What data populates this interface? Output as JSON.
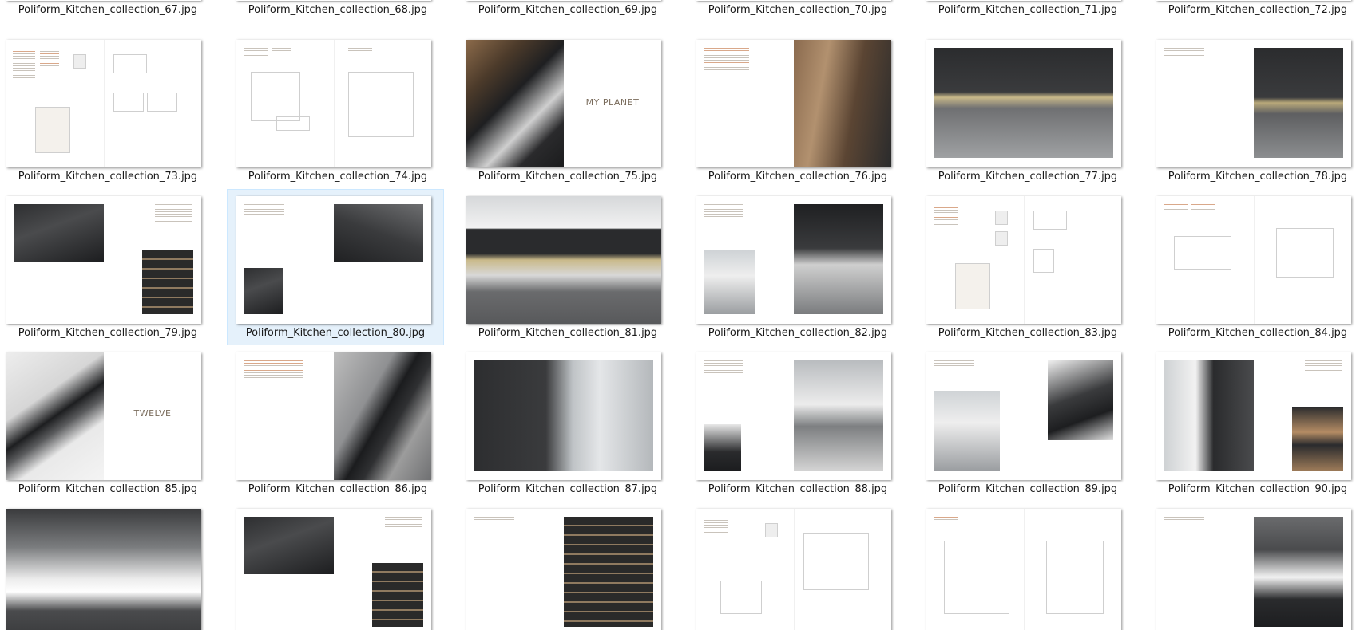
{
  "row0": [
    "Poliform_Kitchen_collection_67.jpg",
    "Poliform_Kitchen_collection_68.jpg",
    "Poliform_Kitchen_collection_69.jpg",
    "Poliform_Kitchen_collection_70.jpg",
    "Poliform_Kitchen_collection_71.jpg",
    "Poliform_Kitchen_collection_72.jpg"
  ],
  "row1": [
    "Poliform_Kitchen_collection_73.jpg",
    "Poliform_Kitchen_collection_74.jpg",
    "Poliform_Kitchen_collection_75.jpg",
    "Poliform_Kitchen_collection_76.jpg",
    "Poliform_Kitchen_collection_77.jpg",
    "Poliform_Kitchen_collection_78.jpg"
  ],
  "row2": [
    "Poliform_Kitchen_collection_79.jpg",
    "Poliform_Kitchen_collection_80.jpg",
    "Poliform_Kitchen_collection_81.jpg",
    "Poliform_Kitchen_collection_82.jpg",
    "Poliform_Kitchen_collection_83.jpg",
    "Poliform_Kitchen_collection_84.jpg"
  ],
  "row3": [
    "Poliform_Kitchen_collection_85.jpg",
    "Poliform_Kitchen_collection_86.jpg",
    "Poliform_Kitchen_collection_87.jpg",
    "Poliform_Kitchen_collection_88.jpg",
    "Poliform_Kitchen_collection_89.jpg",
    "Poliform_Kitchen_collection_90.jpg"
  ],
  "thumb_text": {
    "my_planet": "MY PLANET",
    "twelve": "TWELVE"
  },
  "selected_file": "Poliform_Kitchen_collection_80.jpg"
}
